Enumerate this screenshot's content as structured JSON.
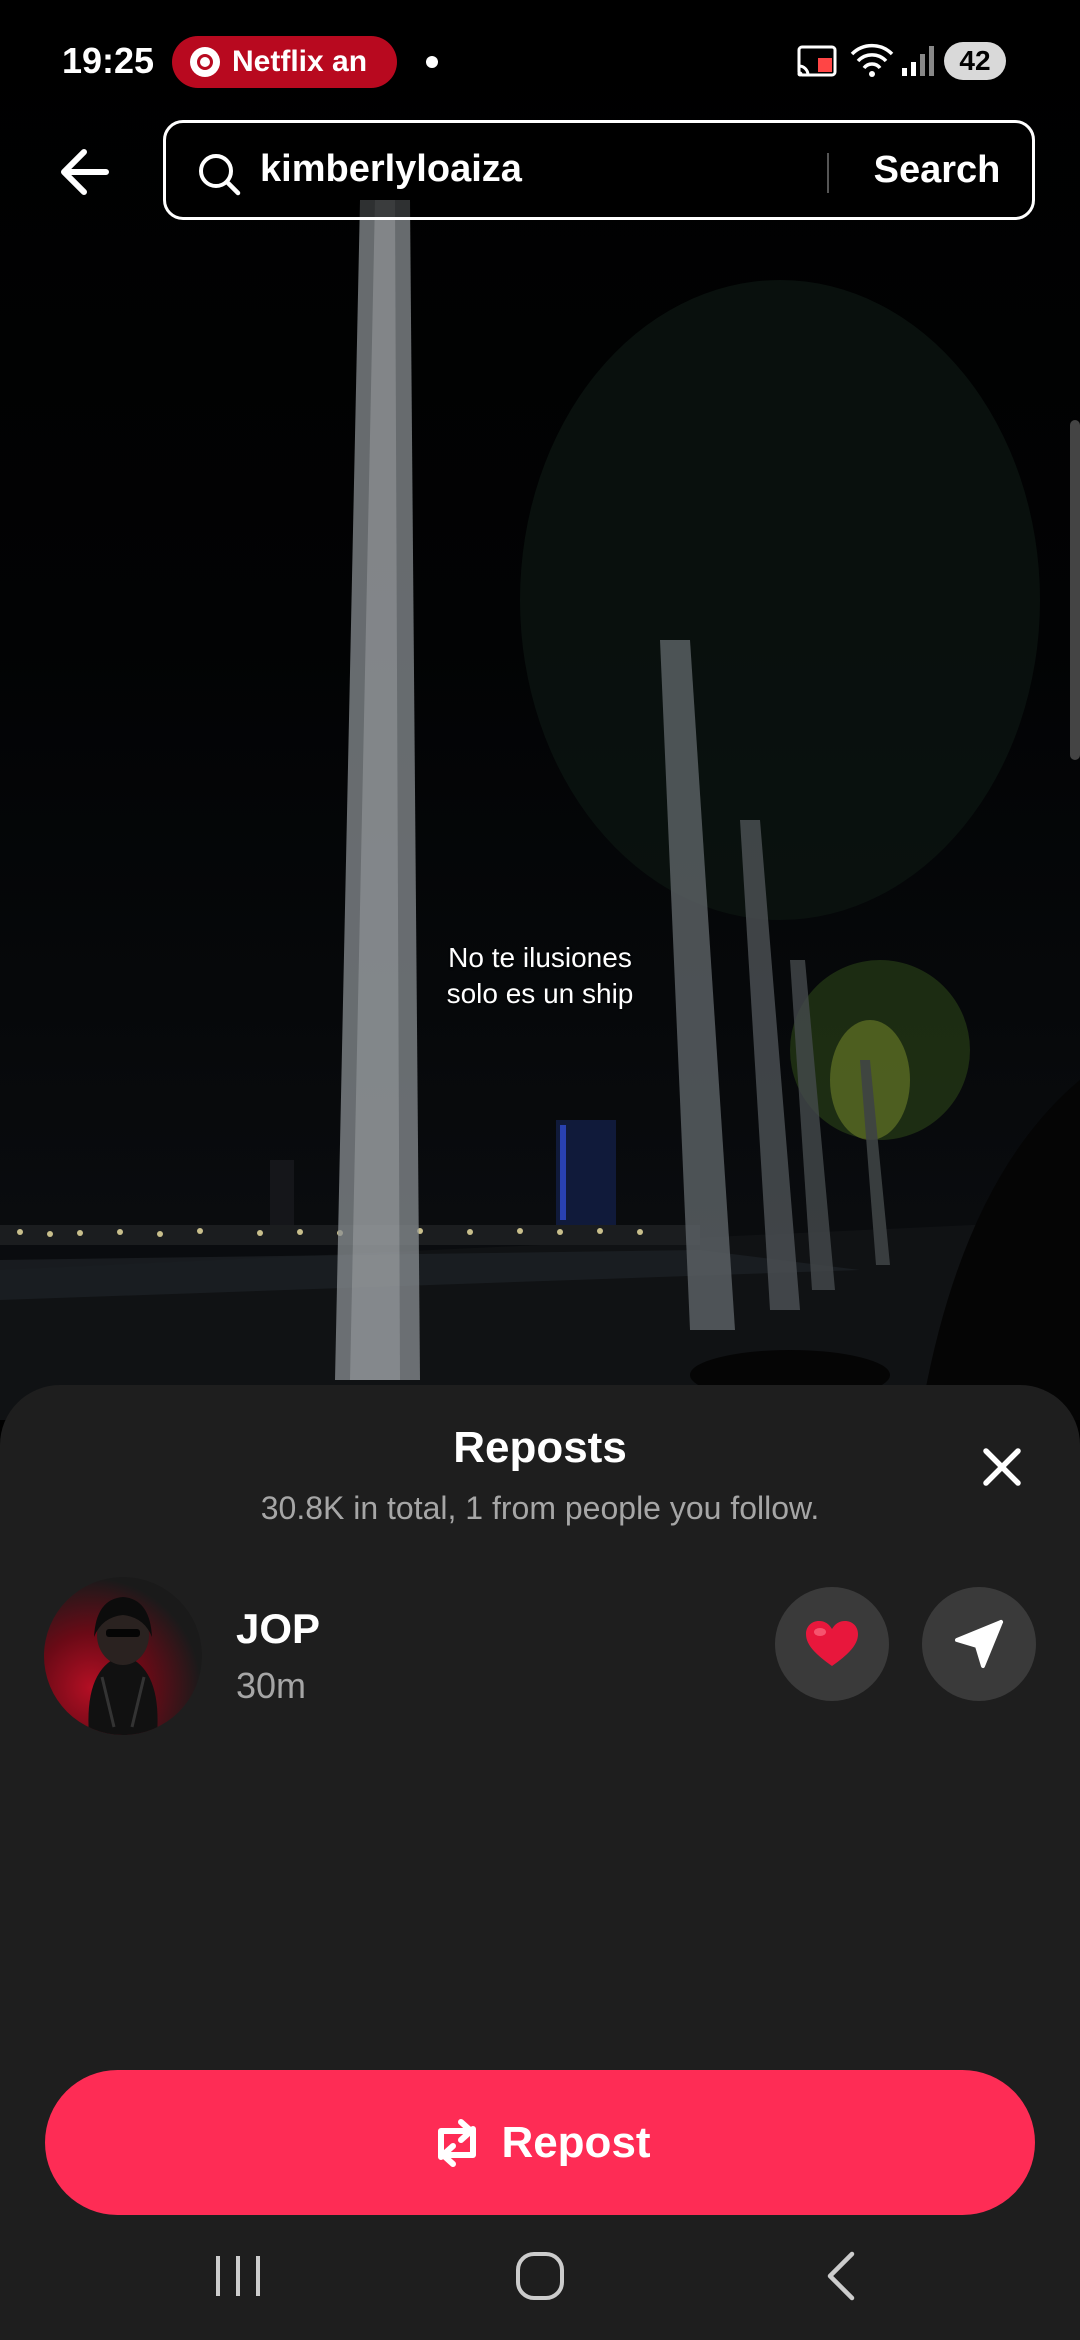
{
  "status_bar": {
    "time": "19:25",
    "notification_app": "Netflix an",
    "battery": "42"
  },
  "search": {
    "query": "kimberlyloaiza",
    "button_label": "Search"
  },
  "video": {
    "caption_line1": "No te ilusiones",
    "caption_line2": "solo es un ship"
  },
  "sheet": {
    "title": "Reposts",
    "subtitle": "30.8K in total, 1 from people you follow.",
    "reposts": [
      {
        "name": "JOP",
        "time": "30m"
      }
    ],
    "repost_button_label": "Repost"
  },
  "colors": {
    "accent": "#fe2c55",
    "sheet_bg": "#1e1e1e",
    "heart": "#e8173c"
  },
  "icons": [
    "back-arrow-icon",
    "search-icon",
    "close-icon",
    "heart-icon",
    "send-icon",
    "repost-icon",
    "cast-icon",
    "wifi-icon",
    "signal-icon"
  ]
}
